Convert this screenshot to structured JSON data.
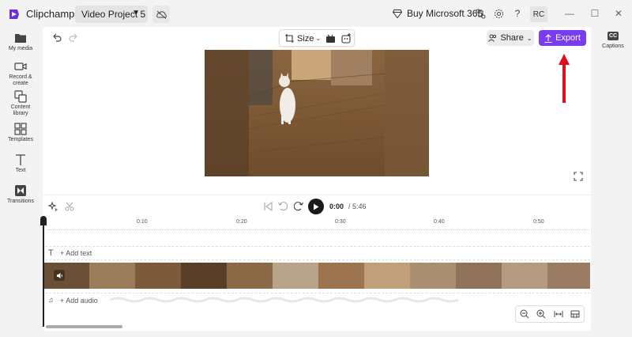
{
  "titlebar": {
    "app_name": "Clipchamp",
    "project_name": "Video Project 5",
    "buy_label": "Buy Microsoft 365",
    "avatar_initials": "RC"
  },
  "sidebar": {
    "items": [
      {
        "label": "My media",
        "icon": "folder-icon"
      },
      {
        "label": "Record & create",
        "icon": "camera-icon"
      },
      {
        "label": "Content library",
        "icon": "content-library-icon"
      },
      {
        "label": "Templates",
        "icon": "templates-icon"
      },
      {
        "label": "Text",
        "icon": "text-icon"
      },
      {
        "label": "Transitions",
        "icon": "transitions-icon"
      }
    ]
  },
  "right_panel": {
    "captions_badge": "CC",
    "captions_label": "Captions"
  },
  "toolbar": {
    "size_label": "Size",
    "share_label": "Share",
    "export_label": "Export"
  },
  "playback": {
    "current_time": "0:00",
    "total_time": "/ 5:46"
  },
  "timeline": {
    "ticks": [
      "0:10",
      "0:20",
      "0:30",
      "0:40",
      "0:50"
    ],
    "add_text_label": "+ Add text",
    "add_audio_label": "+ Add audio"
  },
  "colors": {
    "accent": "#7a3cf0",
    "annotation_arrow": "#e0101a"
  }
}
